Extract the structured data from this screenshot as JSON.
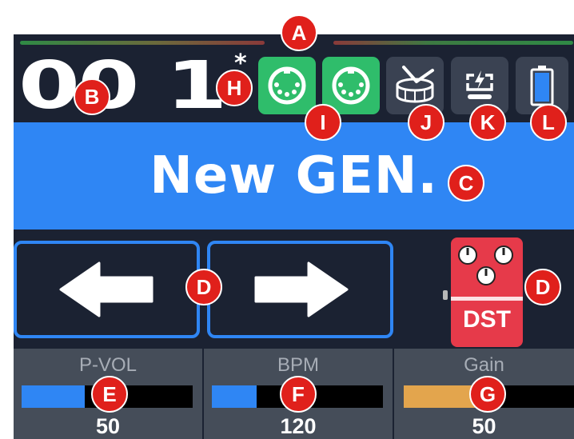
{
  "header": {
    "patch_number": "00 1",
    "modified_marker": "*",
    "indicators": [
      {
        "name": "midi-in",
        "icon": "midi-din-icon",
        "state": "on"
      },
      {
        "name": "midi-out",
        "icon": "midi-din-icon",
        "state": "on"
      },
      {
        "name": "drum",
        "icon": "snare-drum-icon",
        "state": "off"
      },
      {
        "name": "power",
        "icon": "usb-power-icon",
        "state": "off"
      },
      {
        "name": "battery",
        "icon": "battery-icon",
        "state": "off"
      }
    ]
  },
  "patch": {
    "name": "New GEN."
  },
  "navigation": {
    "prev_icon": "arrow-left-icon",
    "next_icon": "arrow-right-icon"
  },
  "effect": {
    "label": "DST",
    "color": "#e63a4a"
  },
  "params": [
    {
      "label": "P-VOL",
      "value": "50",
      "fill_fraction": 0.37,
      "color": "#2f86f4"
    },
    {
      "label": "BPM",
      "value": "120",
      "fill_fraction": 0.26,
      "color": "#2f86f4"
    },
    {
      "label": "Gain",
      "value": "50",
      "fill_fraction": 0.43,
      "color": "#e3a54d"
    }
  ],
  "callouts": [
    "A",
    "B",
    "C",
    "D",
    "D",
    "E",
    "F",
    "G",
    "H",
    "I",
    "J",
    "K",
    "L"
  ],
  "colors": {
    "background": "#1b2232",
    "accent_blue": "#2f86f4",
    "midi_on_green": "#2fbd6b",
    "callout_red": "#e0201b"
  }
}
